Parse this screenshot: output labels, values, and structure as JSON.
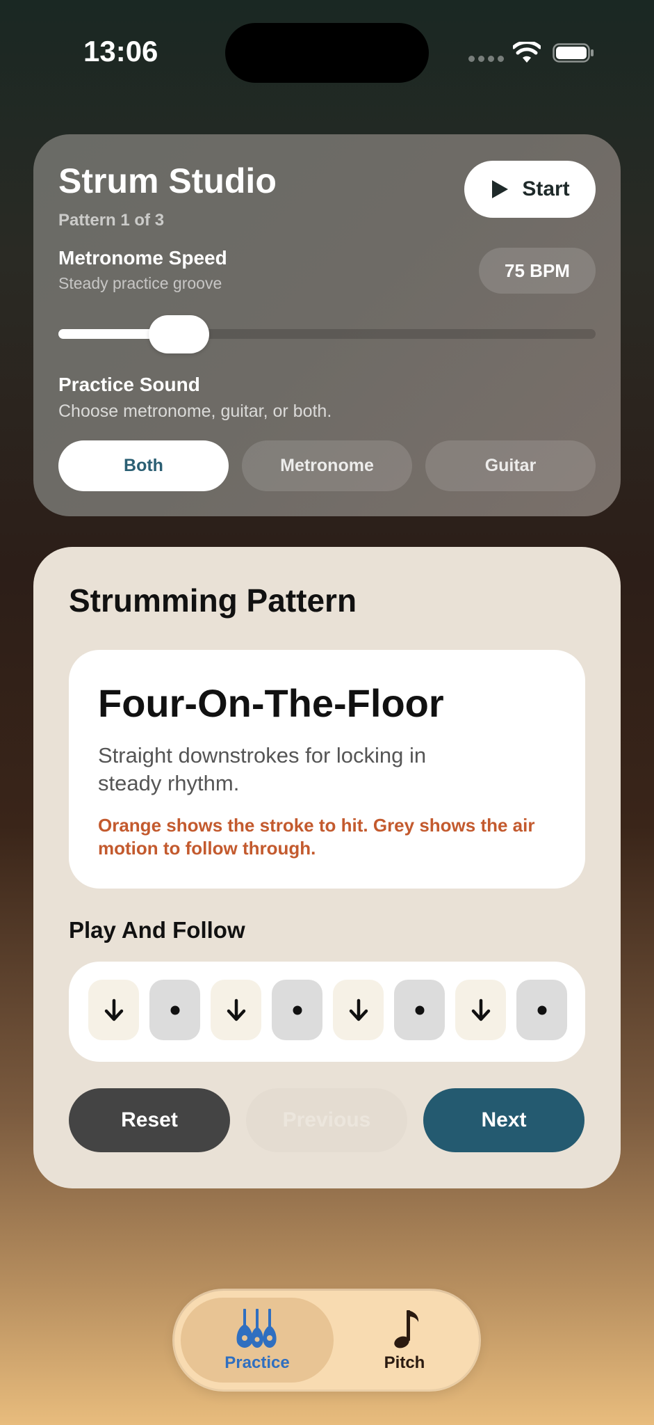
{
  "status_bar": {
    "time": "13:06"
  },
  "header": {
    "title": "Strum Studio",
    "subtitle": "Pattern 1 of 3",
    "start_label": "Start"
  },
  "metronome": {
    "label": "Metronome Speed",
    "description": "Steady practice groove",
    "bpm_text": "75 BPM",
    "slider_fraction": 0.225
  },
  "sound": {
    "label": "Practice Sound",
    "description": "Choose metronome, guitar, or both.",
    "options": [
      {
        "label": "Both",
        "selected": true
      },
      {
        "label": "Metronome",
        "selected": false
      },
      {
        "label": "Guitar",
        "selected": false
      }
    ]
  },
  "pattern": {
    "heading": "Strumming Pattern",
    "name": "Four-On-The-Floor",
    "description": "Straight downstrokes for locking in steady rhythm.",
    "hint": "Orange shows the stroke to hit. Grey shows the air motion to follow through.",
    "follow_label": "Play And Follow",
    "strokes": [
      "down",
      "air",
      "down",
      "air",
      "down",
      "air",
      "down",
      "air"
    ]
  },
  "actions": {
    "reset": "Reset",
    "previous": "Previous",
    "next": "Next"
  },
  "tabs": {
    "practice": "Practice",
    "pitch": "Pitch"
  },
  "colors": {
    "accent_blue": "#245a70",
    "hint_orange": "#c35a2e",
    "tab_active_text": "#2f6fc0"
  },
  "icons": {
    "start": "play-icon",
    "stroke_down": "arrow-down-icon",
    "stroke_air": "dot-icon",
    "practice_tab": "guitars-icon",
    "pitch_tab": "music-note-icon"
  }
}
